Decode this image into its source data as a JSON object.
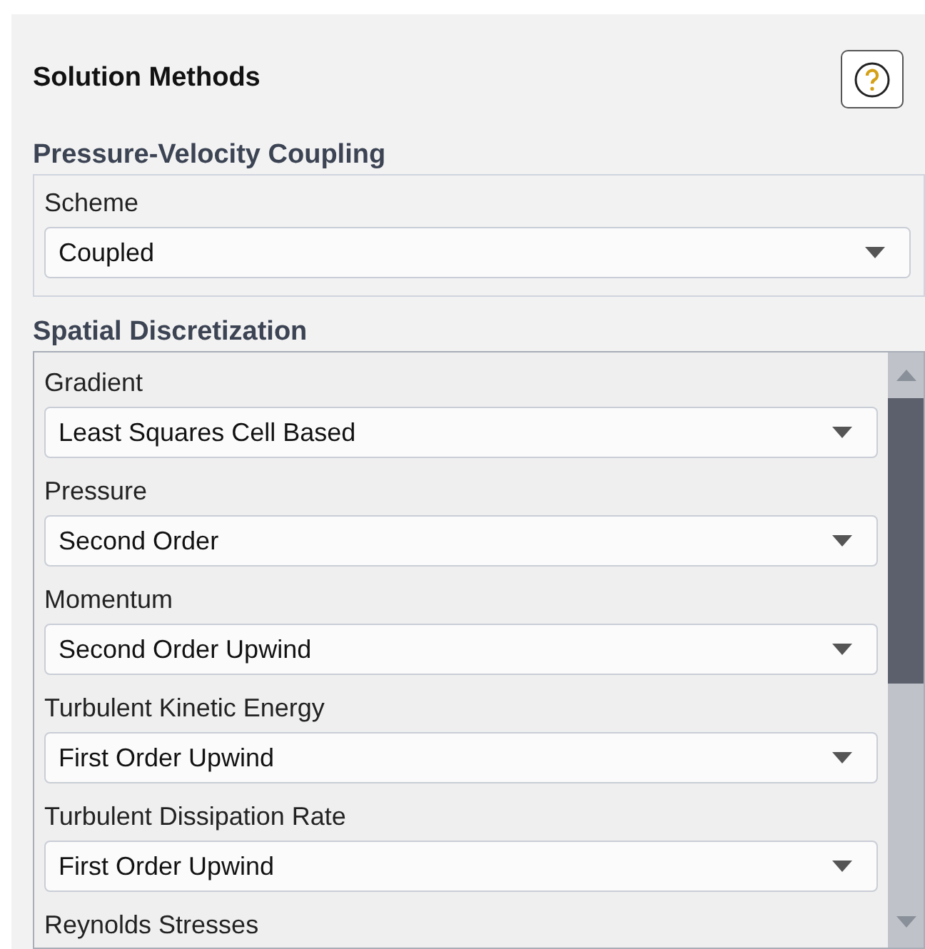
{
  "panel": {
    "title": "Solution Methods"
  },
  "pressure_velocity_coupling": {
    "heading": "Pressure-Velocity Coupling",
    "fields": [
      {
        "label": "Scheme",
        "value": "Coupled"
      }
    ]
  },
  "spatial_discretization": {
    "heading": "Spatial Discretization",
    "fields": [
      {
        "label": "Gradient",
        "value": "Least Squares Cell Based"
      },
      {
        "label": "Pressure",
        "value": "Second Order"
      },
      {
        "label": "Momentum",
        "value": "Second Order Upwind"
      },
      {
        "label": "Turbulent Kinetic Energy",
        "value": "First Order Upwind"
      },
      {
        "label": "Turbulent Dissipation Rate",
        "value": "First Order Upwind"
      },
      {
        "label": "Reynolds Stresses"
      }
    ]
  }
}
